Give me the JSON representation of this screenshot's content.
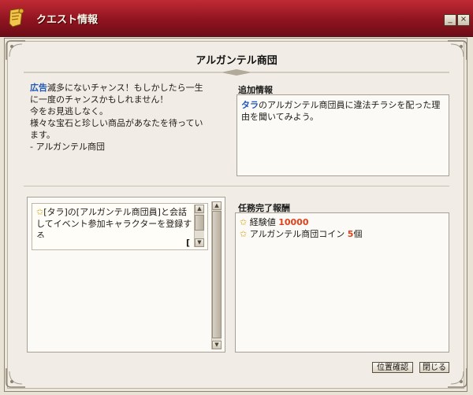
{
  "window": {
    "title": "クエスト情報",
    "minimize_label": "_",
    "close_label": "×",
    "title_bar_color": "#8f1420",
    "icon": "scroll-icon"
  },
  "quest": {
    "title": "アルガンテル商団",
    "advertisement": {
      "tag": "広告",
      "lines": [
        "滅多にないチャンス！もしかしたら一生",
        "に一度のチャンスかもしれません！",
        "今をお見逃しなく。",
        "様々な宝石と珍しい商品があなたを待ってい",
        "ます。",
        "- アルガンテル商団"
      ]
    },
    "extra_info": {
      "header": "追加情報",
      "tag": "タラ",
      "text": "のアルガンテル商団員に違法チラシを配った理由を聞いてみよう。"
    },
    "objective": {
      "icon": "star-icon",
      "text": "[タラ]の[アルガンテル商団員]と会話してイベント参加キャラクターを登録する",
      "count": "[ ]"
    },
    "rewards": {
      "header": "任務完了報酬",
      "items": [
        {
          "icon": "star-icon",
          "label": "経験値",
          "amount": "10000",
          "suffix": ""
        },
        {
          "icon": "star-icon",
          "label": "アルガンテル商団コイン",
          "amount": "5",
          "suffix": "個"
        }
      ],
      "amount_color": "#e0411a"
    }
  },
  "buttons": {
    "position_check": "位置確認",
    "close": "閉じる"
  },
  "colors": {
    "link_blue": "#1e57b8",
    "star_gold": "#d8a410"
  }
}
